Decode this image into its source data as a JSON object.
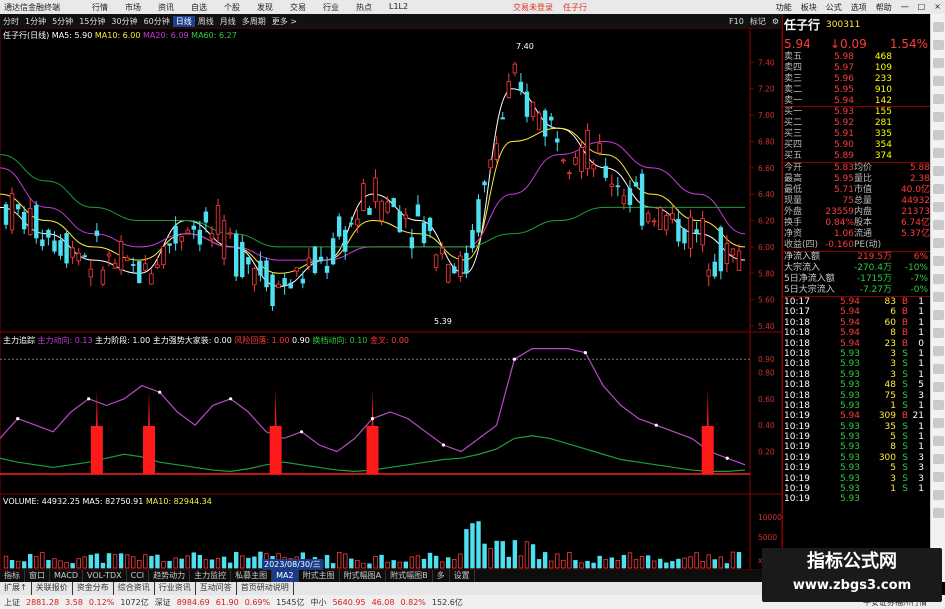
{
  "window": {
    "title": "通达信金融终端",
    "menu": [
      "行情",
      "市场",
      "资讯",
      "自选",
      "个股",
      "发现",
      "交易",
      "行业",
      "热点",
      "L1L2"
    ],
    "center": [
      "交易未登录",
      "任子行"
    ],
    "right": [
      "功能",
      "板块",
      "公式",
      "选项",
      "帮助",
      "一",
      "□",
      "×"
    ]
  },
  "toolbar": {
    "periods": [
      "分时",
      "1分钟",
      "5分钟",
      "15分钟",
      "30分钟",
      "60分钟",
      "日线",
      "周线",
      "月线",
      "多周期",
      "更多 >"
    ],
    "active": "日线",
    "right": [
      "F10",
      "标记",
      "⚙"
    ]
  },
  "chart_header": {
    "main": "任子行(日线)",
    "ma5": "MA5: 5.90",
    "ma10": "MA10: 6.00",
    "ma20": "MA20: 6.09",
    "ma60": "MA60: 6.27",
    "high": "7.40",
    "low": "5.39",
    "indicator": "主力追踪",
    "ind_items": [
      "主力动向: 0.13",
      "主力阶段: 1.00",
      "主力强势大家装: 0.00",
      "风险回落: 1.00",
      "0.90",
      "换档动向: 0.10",
      "金叉: 0.00"
    ],
    "volume": "VOLUME: 44932.25",
    "vol_ma5": "MA5: 82750.91",
    "vol_ma10": "MA10: 82944.34",
    "date_label": "2023/08/30/三"
  },
  "chart_data": [
    {
      "type": "line",
      "title": "任子行(日线)",
      "series": [
        {
          "name": "MA5",
          "values": [
            6.3,
            6.1,
            5.9,
            5.8,
            6.2,
            6.0,
            5.7,
            5.9,
            6.4,
            6.2,
            5.8,
            7.2,
            6.9,
            6.6,
            6.3,
            6.1,
            5.9
          ]
        },
        {
          "name": "MA10",
          "values": [
            6.4,
            6.2,
            6.0,
            5.9,
            6.1,
            6.0,
            5.8,
            5.9,
            6.2,
            6.1,
            5.9,
            6.8,
            6.9,
            6.7,
            6.4,
            6.2,
            6.0
          ]
        },
        {
          "name": "MA20",
          "values": [
            6.6,
            6.3,
            6.1,
            6.0,
            6.1,
            6.0,
            5.9,
            5.9,
            6.0,
            6.0,
            6.0,
            6.4,
            6.7,
            6.8,
            6.6,
            6.4,
            6.1
          ]
        },
        {
          "name": "MA60",
          "values": [
            6.7,
            6.5,
            6.3,
            6.2,
            6.2,
            6.1,
            6.0,
            6.0,
            6.0,
            6.0,
            6.0,
            6.1,
            6.2,
            6.3,
            6.3,
            6.3,
            6.3
          ]
        }
      ],
      "ylim": [
        5.4,
        7.6
      ],
      "y_ticks": [
        "7.40",
        "7.20",
        "7.00",
        "6.80",
        "6.60",
        "6.40",
        "6.20",
        "6.00",
        "5.80",
        "5.60",
        "5.40"
      ]
    },
    {
      "type": "bar",
      "title": "主力追踪",
      "spike_positions": [
        0.13,
        0.2,
        0.37,
        0.5,
        0.95
      ],
      "ylim": [
        0,
        1
      ],
      "y_ticks": [
        "0.90",
        "0.80",
        "0.60",
        "0.40",
        "0.20"
      ]
    },
    {
      "type": "bar",
      "title": "VOLUME",
      "y_ticks": [
        "10000",
        "5000",
        "x10"
      ]
    }
  ],
  "quote": {
    "name": "任子行",
    "code": "300311",
    "price": "5.94",
    "change": "↓0.09",
    "pct": "1.54%",
    "asks": [
      {
        "label": "卖五",
        "price": "5.98",
        "vol": "468"
      },
      {
        "label": "卖四",
        "price": "5.97",
        "vol": "109"
      },
      {
        "label": "卖三",
        "price": "5.96",
        "vol": "233"
      },
      {
        "label": "卖二",
        "price": "5.95",
        "vol": "910"
      },
      {
        "label": "卖一",
        "price": "5.94",
        "vol": "142"
      }
    ],
    "bids": [
      {
        "label": "买一",
        "price": "5.93",
        "vol": "155"
      },
      {
        "label": "买二",
        "price": "5.92",
        "vol": "281"
      },
      {
        "label": "买三",
        "price": "5.91",
        "vol": "335"
      },
      {
        "label": "买四",
        "price": "5.90",
        "vol": "354"
      },
      {
        "label": "买五",
        "price": "5.89",
        "vol": "374"
      }
    ],
    "stats": [
      {
        "k1": "今开",
        "v1": "5.83",
        "k2": "均价",
        "v2": "5.88"
      },
      {
        "k1": "最高",
        "v1": "5.95",
        "k2": "量比",
        "v2": "2.38"
      },
      {
        "k1": "最低",
        "v1": "5.71",
        "k2": "市值",
        "v2": "40.0亿"
      },
      {
        "k1": "现量",
        "v1": "75",
        "k2": "总量",
        "v2": "44932"
      },
      {
        "k1": "外盘",
        "v1": "23559",
        "k2": "内盘",
        "v2": "21373"
      },
      {
        "k1": "换手",
        "v1": "0.84%",
        "k2": "股本",
        "v2": "6.74亿"
      },
      {
        "k1": "净资",
        "v1": "1.06",
        "k2": "流通",
        "v2": "5.37亿"
      },
      {
        "k1": "收益(四)",
        "v1": "-0.160",
        "k2": "PE(动)",
        "v2": ""
      }
    ],
    "flows": [
      {
        "k": "净流入额",
        "v": "219.5万",
        "p": "6%"
      },
      {
        "k": "大宗流入",
        "v": "-270.4万",
        "p": "-10%"
      },
      {
        "k": "5日净流入额",
        "v": "-1715万",
        "p": "-7%"
      },
      {
        "k": "5日大宗流入",
        "v": "-7.27万",
        "p": "-0%"
      }
    ],
    "ticks": [
      {
        "t": "10:17",
        "p": "5.94",
        "v": "83",
        "s": "B",
        "n": "1"
      },
      {
        "t": "10:17",
        "p": "5.94",
        "v": "6",
        "s": "B",
        "n": "1"
      },
      {
        "t": "10:18",
        "p": "5.94",
        "v": "60",
        "s": "B",
        "n": "1"
      },
      {
        "t": "10:18",
        "p": "5.94",
        "v": "8",
        "s": "B",
        "n": "1"
      },
      {
        "t": "10:18",
        "p": "5.94",
        "v": "23",
        "s": "B",
        "n": "0"
      },
      {
        "t": "10:18",
        "p": "5.93",
        "v": "3",
        "s": "S",
        "n": "1"
      },
      {
        "t": "10:18",
        "p": "5.93",
        "v": "3",
        "s": "S",
        "n": "1"
      },
      {
        "t": "10:18",
        "p": "5.93",
        "v": "3",
        "s": "S",
        "n": "1"
      },
      {
        "t": "10:18",
        "p": "5.93",
        "v": "48",
        "s": "S",
        "n": "5"
      },
      {
        "t": "10:18",
        "p": "5.93",
        "v": "75",
        "s": "S",
        "n": "3"
      },
      {
        "t": "10:18",
        "p": "5.93",
        "v": "1",
        "s": "S",
        "n": "1"
      },
      {
        "t": "10:19",
        "p": "5.94",
        "v": "309",
        "s": "B",
        "n": "21"
      },
      {
        "t": "10:19",
        "p": "5.93",
        "v": "35",
        "s": "S",
        "n": "1"
      },
      {
        "t": "10:19",
        "p": "5.93",
        "v": "5",
        "s": "S",
        "n": "1"
      },
      {
        "t": "10:19",
        "p": "5.93",
        "v": "8",
        "s": "S",
        "n": "1"
      },
      {
        "t": "10:19",
        "p": "5.93",
        "v": "300",
        "s": "S",
        "n": "3"
      },
      {
        "t": "10:19",
        "p": "5.93",
        "v": "5",
        "s": "S",
        "n": "3"
      },
      {
        "t": "10:19",
        "p": "5.93",
        "v": "3",
        "s": "S",
        "n": "3"
      },
      {
        "t": "10:19",
        "p": "5.93",
        "v": "1",
        "s": "S",
        "n": "1"
      },
      {
        "t": "10:19",
        "p": "5.93",
        "v": "",
        "s": "",
        "n": ""
      }
    ]
  },
  "tabs": {
    "items": [
      "指标",
      "窗口",
      "MACD",
      "VOL-TDX",
      "CCI",
      "趋势动力",
      "主力监控",
      "私募主图",
      "MA2",
      "附式主图",
      "附式幅图A",
      "附式幅图B",
      "多",
      "设置"
    ],
    "active": "MA2"
  },
  "tabs2": [
    "扩展↑",
    "关联报价",
    "资金分布",
    "综合资讯",
    "行业资讯",
    "互动问答",
    "首页研动说明"
  ],
  "status": {
    "sh": "上证",
    "sh_val": "2881.28",
    "sh_chg": "3.58",
    "sh_pct": "0.12%",
    "sh_amt": "1072亿",
    "sz": "深证",
    "sz_val": "8984.69",
    "sz_chg": "61.90",
    "sz_pct": "0.69%",
    "sz_amt": "1545亿",
    "zx": "中小",
    "zx_val": "5640.95",
    "zx_chg": "46.08",
    "zx_pct": "0.82%",
    "zx_amt": "152.6亿",
    "broker": "平安证券福州行情"
  },
  "watermark": {
    "line1": "指标公式网",
    "line2": "www.zbgs3.com"
  },
  "colors": {
    "up": "#ff3b3b",
    "down": "#4fe0f0",
    "ma5": "#ffffff",
    "ma10": "#ffeb3b",
    "ma20": "#c63bd6",
    "ma60": "#1e9e3a",
    "border": "#8b0000"
  }
}
